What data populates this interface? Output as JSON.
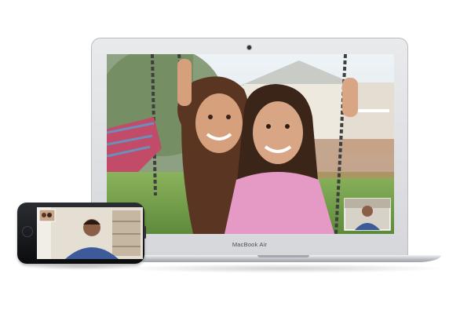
{
  "laptop": {
    "brand_label": "MacBook Air"
  },
  "colors": {
    "aluminum": "#d9dbde",
    "phone_body": "#15171a",
    "sky": "#dfe8ef",
    "grass": "#7aa550",
    "pink_jacket": "#e59ac6",
    "plaid_shirt": "#c34b6a",
    "blue_shirt": "#3d5b9a"
  },
  "icons": [
    "camera-dot",
    "home-button-icon"
  ]
}
